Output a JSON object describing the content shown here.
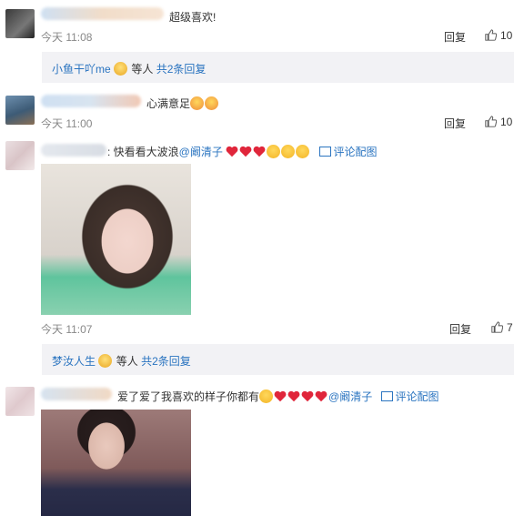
{
  "comments": [
    {
      "text": "超级喜欢!",
      "time": "今天 11:08",
      "reply_label": "回复",
      "likes": "10",
      "sub_reply": {
        "user": "小鱼干吖me",
        "suffix": "等人",
        "more": "共2条回复"
      }
    },
    {
      "text": "心满意足",
      "time": "今天 11:00",
      "reply_label": "回复",
      "likes": "10"
    },
    {
      "text_prefix": ": 快看看大波浪",
      "mention": "@阚清子",
      "pic_link": "评论配图",
      "time": "今天 11:07",
      "reply_label": "回复",
      "likes": "7",
      "sub_reply": {
        "user": "梦汝人生",
        "suffix": "等人",
        "more": "共2条回复"
      }
    },
    {
      "text_prefix": "爱了爱了我喜欢的样子你都有",
      "mention": "@阚清子",
      "pic_link": "评论配图"
    }
  ],
  "colors": {
    "link": "#2a74c0",
    "time": "#888888",
    "subbox_bg": "#f2f2f5",
    "heart": "#e0263b"
  }
}
